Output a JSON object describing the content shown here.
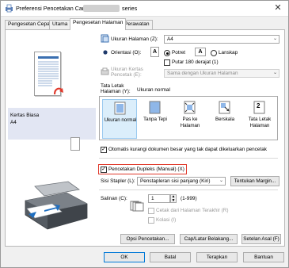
{
  "window": {
    "title": "Preferensi Pencetakan Canon",
    "title_suffix": "series",
    "close_glyph": "✕"
  },
  "tabs": [
    {
      "label": "Pengesetan Cepat"
    },
    {
      "label": "Utama"
    },
    {
      "label": "Pengesetan Halaman"
    },
    {
      "label": "Perawatan"
    }
  ],
  "left_pane": {
    "paper_name": "Kertas Biasa",
    "paper_size": "A4"
  },
  "page_size": {
    "label": "Ukuran Halaman (Z):",
    "value": "A4"
  },
  "orientation": {
    "label": "Orientasi (O):",
    "portrait_label": "Potret",
    "landscape_label": "Lanskap",
    "selected": "portrait",
    "rotate_label": "Putar 180 derajat (1)"
  },
  "printer_paper_size": {
    "label_line1": "Ukuran Kertas",
    "label_line2": "Pencetak (E):",
    "value": "Sama dengan Ukuran Halaman"
  },
  "page_layout": {
    "label_line1": "Tata Letak",
    "label_line2": "Halaman (Y):",
    "current": "Ukuran normal",
    "items": [
      {
        "label": "Ukuran normal",
        "icon": "normal-size-icon",
        "selected": true
      },
      {
        "label": "Tanpa Tepi",
        "icon": "borderless-icon",
        "selected": false
      },
      {
        "label": "Pas ke Halaman",
        "icon": "fit-to-page-icon",
        "selected": false
      },
      {
        "label": "Berskala",
        "icon": "scaled-icon",
        "selected": false
      },
      {
        "label": "Tata Letak Halaman",
        "icon": "page-layout-icon",
        "selected": false
      }
    ],
    "fit_number": "2"
  },
  "auto_reduce": {
    "label": "Otomatis kurangi dokumen besar yang tak dapat dikeluarkan pencetak",
    "checked": true
  },
  "duplex": {
    "label": "Pencetakan Dupleks (Manual) (X)",
    "checked": true
  },
  "stapling": {
    "label": "Sisi Stapler (L):",
    "value": "Penstapleran sisi panjang (Kiri)",
    "margin_button": "Tentukan Margin..."
  },
  "copies": {
    "label": "Salinan (C):",
    "value": "1",
    "range": "(1-999)",
    "last_page_first_label": "Cetak dari Halaman Terakhir (R)",
    "collate_label": "Kolasi (I)"
  },
  "bottom_buttons": {
    "print_options": "Opsi Pencetakan...",
    "stamp_background": "Cap/Latar Belakang...",
    "defaults": "Setelan Asal (F)"
  },
  "dialog_buttons": {
    "ok": "OK",
    "cancel": "Batal",
    "apply": "Terapkan",
    "help": "Bantuan"
  },
  "colors": {
    "accent": "#0078d7",
    "highlight_border": "#e0392b",
    "selection_fill": "#dbeefb",
    "info_band": "#e2e6f3"
  }
}
